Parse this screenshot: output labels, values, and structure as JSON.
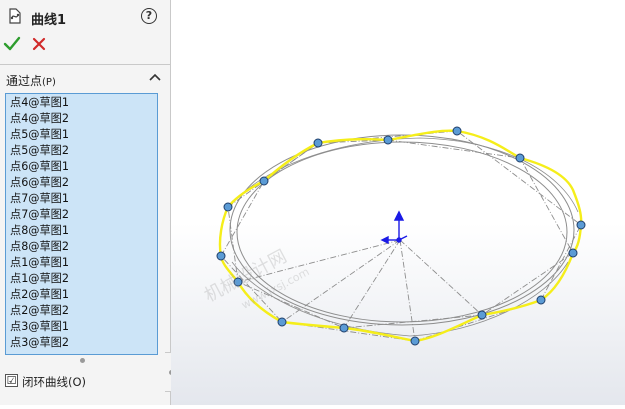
{
  "feature": {
    "title": "曲线1",
    "help": "?"
  },
  "actions": {
    "ok": "✓",
    "cancel": "✕"
  },
  "through_points": {
    "label": "通过点",
    "shortcut": "(P)",
    "items": [
      "点4@草图1",
      "点4@草图2",
      "点5@草图1",
      "点5@草图2",
      "点6@草图1",
      "点6@草图2",
      "点7@草图1",
      "点7@草图2",
      "点8@草图1",
      "点8@草图2",
      "点1@草图1",
      "点1@草图2",
      "点2@草图1",
      "点2@草图2",
      "点3@草图1",
      "点3@草图2"
    ]
  },
  "closed_curve": {
    "label": "闭环曲线(O)",
    "checked": true,
    "mark": "☑"
  },
  "watermark": {
    "text": "机械设计网",
    "url": "www.jxsj.com"
  },
  "colors": {
    "curve": "#f5ee1a",
    "point": "#5b9bd5",
    "selection_bg": "#cce4f7",
    "triad": "#1a1ae6"
  }
}
